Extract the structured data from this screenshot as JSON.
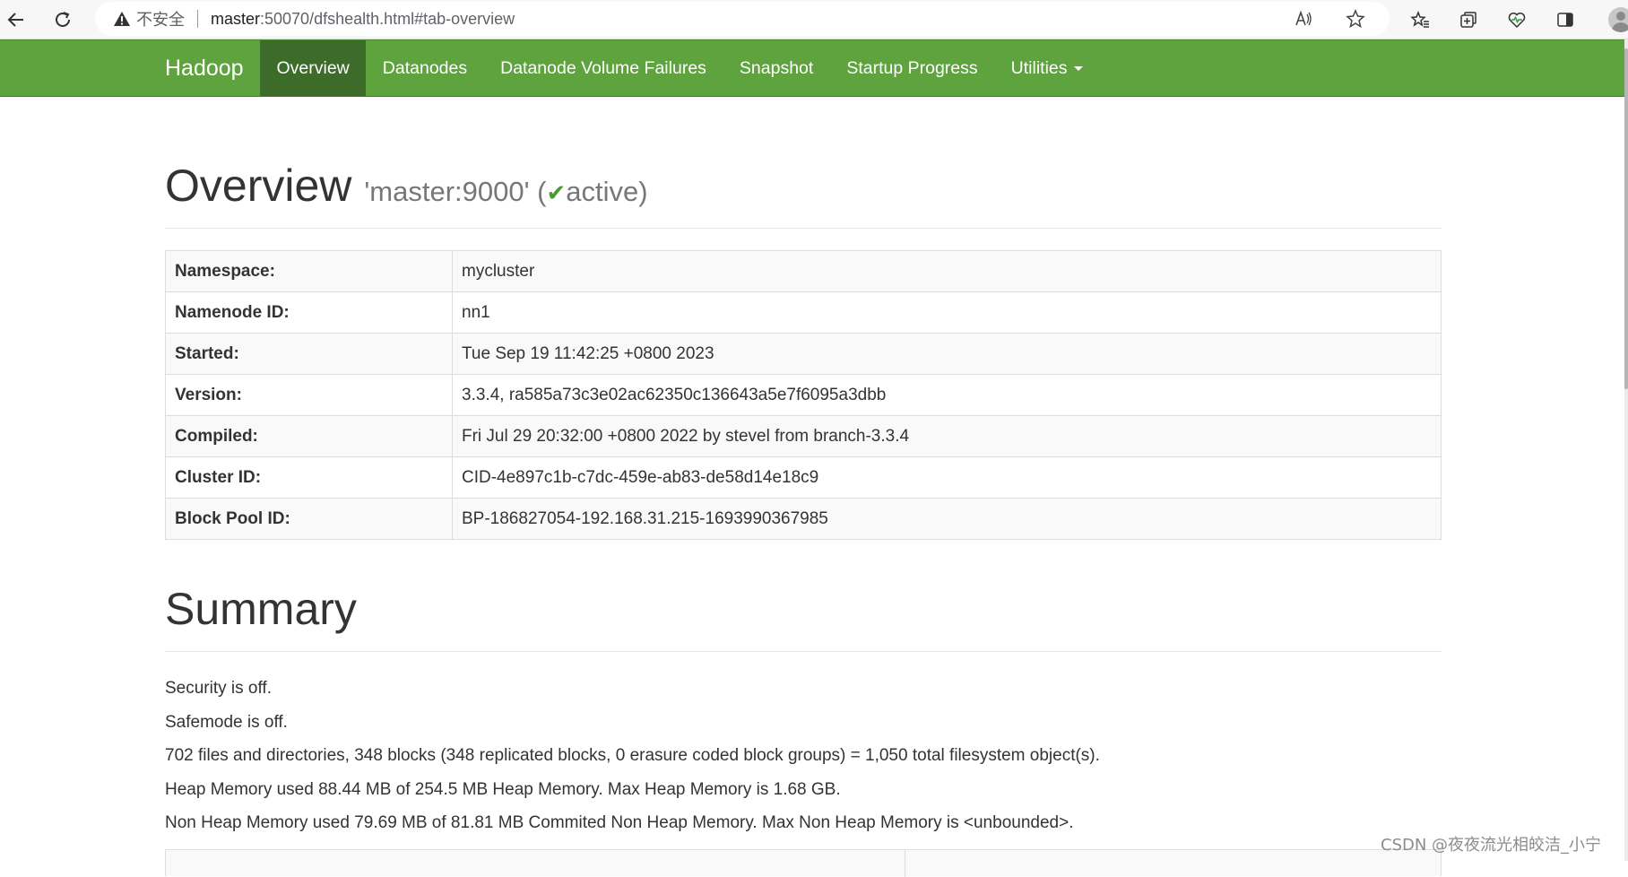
{
  "browser": {
    "insecure_label": "不安全",
    "url_host": "master",
    "url_rest": ":50070/dfshealth.html#tab-overview"
  },
  "navbar": {
    "brand": "Hadoop",
    "items": [
      {
        "label": "Overview",
        "active": true
      },
      {
        "label": "Datanodes"
      },
      {
        "label": "Datanode Volume Failures"
      },
      {
        "label": "Snapshot"
      },
      {
        "label": "Startup Progress"
      },
      {
        "label": "Utilities"
      }
    ]
  },
  "overview": {
    "title": "Overview",
    "host_label": "'master:9000' (",
    "status": "active",
    "status_close": ")",
    "rows": [
      {
        "key": "Namespace:",
        "value": "mycluster"
      },
      {
        "key": "Namenode ID:",
        "value": "nn1"
      },
      {
        "key": "Started:",
        "value": "Tue Sep 19 11:42:25 +0800 2023"
      },
      {
        "key": "Version:",
        "value": "3.3.4, ra585a73c3e02ac62350c136643a5e7f6095a3dbb"
      },
      {
        "key": "Compiled:",
        "value": "Fri Jul 29 20:32:00 +0800 2022 by stevel from branch-3.3.4"
      },
      {
        "key": "Cluster ID:",
        "value": "CID-4e897c1b-c7dc-459e-ab83-de58d14e18c9"
      },
      {
        "key": "Block Pool ID:",
        "value": "BP-186827054-192.168.31.215-1693990367985"
      }
    ]
  },
  "summary": {
    "title": "Summary",
    "lines": [
      "Security is off.",
      "Safemode is off.",
      "702 files and directories, 348 blocks (348 replicated blocks, 0 erasure coded block groups) = 1,050 total filesystem object(s).",
      "Heap Memory used 88.44 MB of 254.5 MB Heap Memory. Max Heap Memory is 1.68 GB.",
      "Non Heap Memory used 79.69 MB of 81.81 MB Commited Non Heap Memory. Max Non Heap Memory is <unbounded>."
    ]
  },
  "watermark": "CSDN @夜夜流光相皎洁_小宁",
  "colors": {
    "navbar": "#5fa33e",
    "navbar_active": "#3d6b2a",
    "active_check": "#4a9a2f"
  }
}
